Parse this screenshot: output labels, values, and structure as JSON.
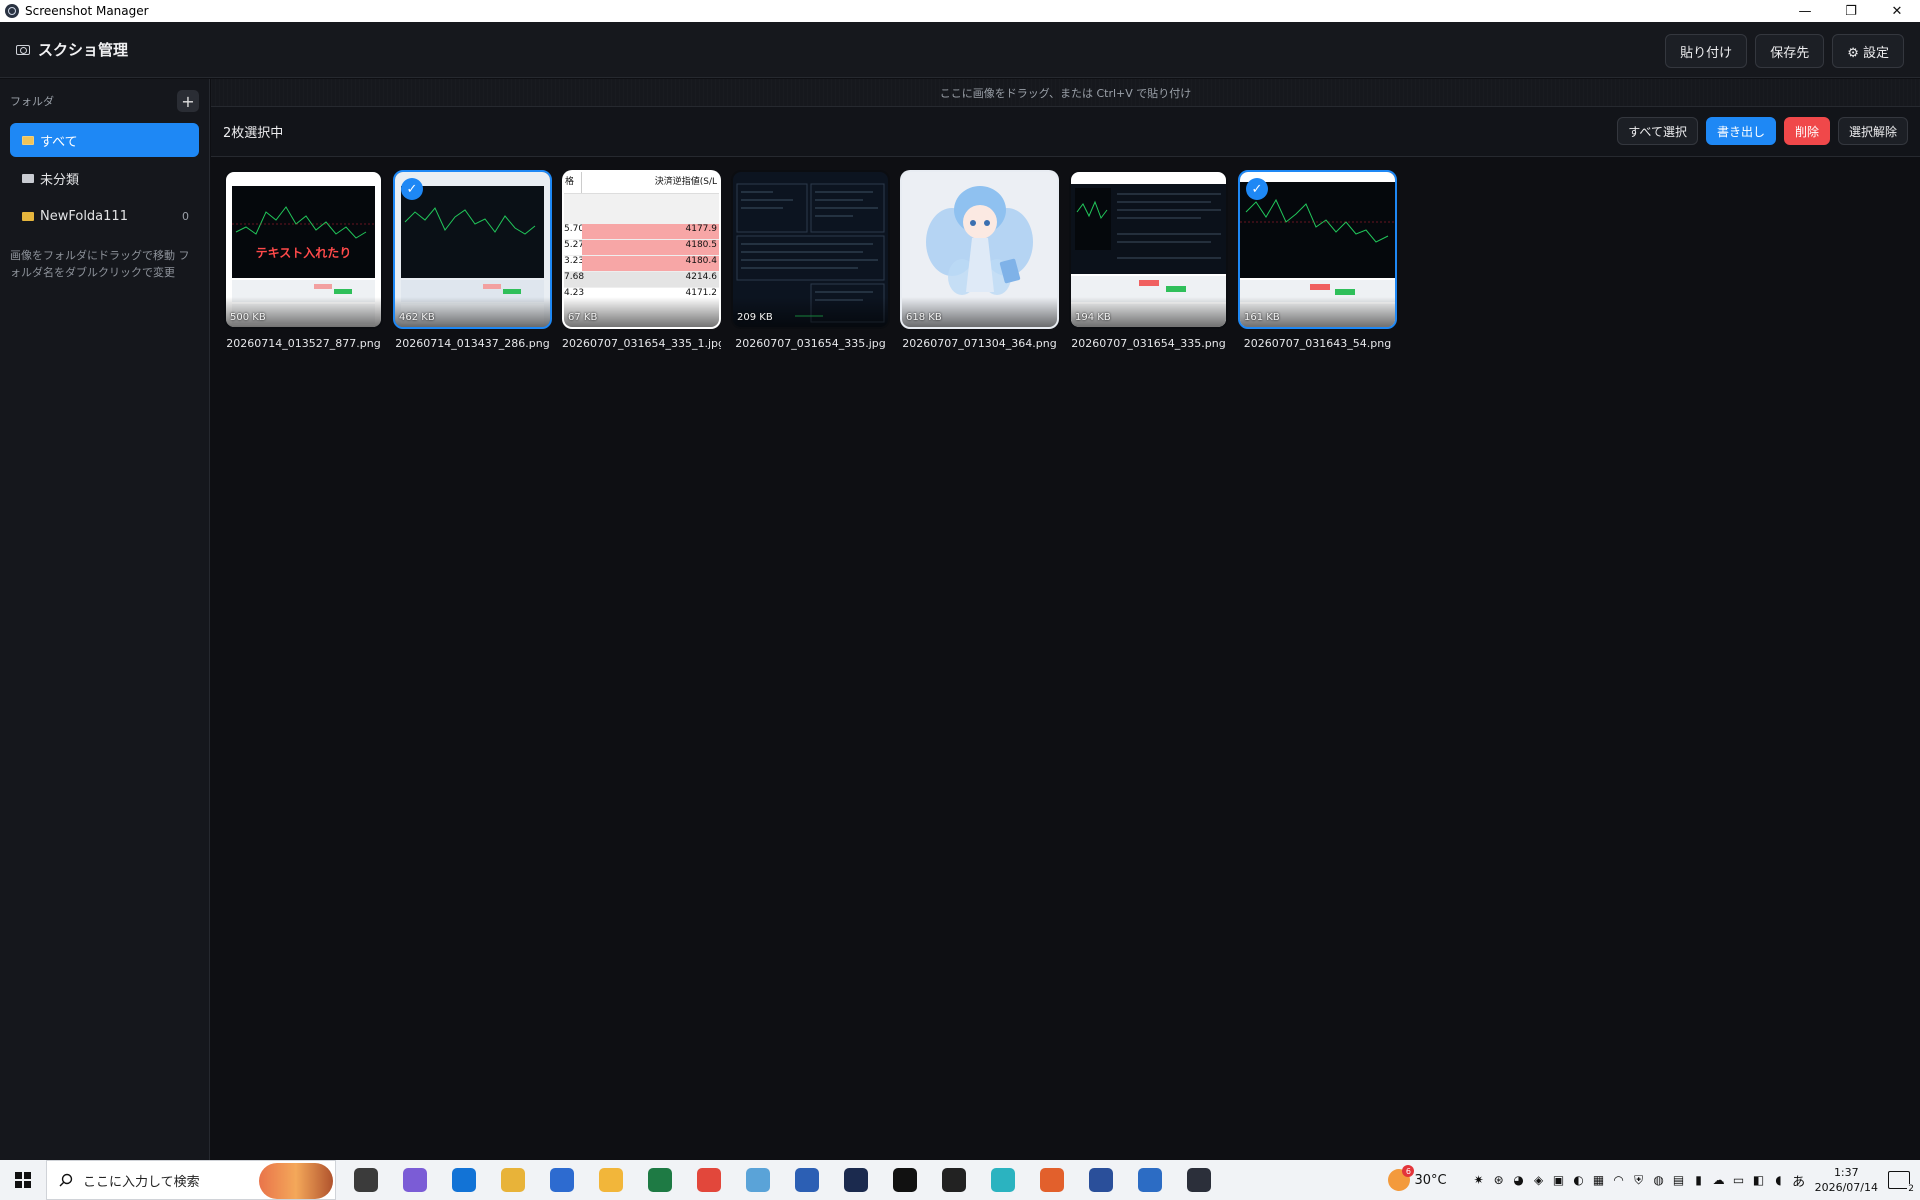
{
  "window": {
    "title": "Screenshot Manager",
    "minimize": "—",
    "restore": "❐",
    "close": "✕"
  },
  "header": {
    "brand": "スクショ管理",
    "paste_label": "貼り付け",
    "save_dest_label": "保存先",
    "settings_label": "⚙ 設定"
  },
  "sidebar": {
    "section_label": "フォルダ",
    "add_label": "+",
    "items": [
      {
        "label": "すべて",
        "count": ""
      },
      {
        "label": "未分類",
        "count": ""
      },
      {
        "label": "NewFolda111",
        "count": "0"
      }
    ],
    "hint": "画像をフォルダにドラッグで移動 フォルダ名をダブルクリックで変更"
  },
  "dropzone": {
    "text": "ここに画像をドラッグ、または Ctrl+V で貼り付け"
  },
  "selection": {
    "count_label": "2枚選択中",
    "select_all_label": "すべて選択",
    "export_label": "書き出し",
    "delete_label": "削除",
    "deselect_label": "選択解除"
  },
  "images": [
    {
      "name": "20260714_013527_877.png",
      "size": "500 KB",
      "selected": false,
      "overlay_text": "テキスト入れたり"
    },
    {
      "name": "20260714_013437_286.png",
      "size": "462 KB",
      "selected": true
    },
    {
      "name": "20260707_031654_335_1.jpg",
      "size": "67 KB",
      "selected": false,
      "header_left": "格",
      "header_right": "決済逆指値(S/L",
      "rows": [
        {
          "left": "5.70",
          "right": "4177.9"
        },
        {
          "left": "5.27",
          "right": "4180.5"
        },
        {
          "left": "3.23",
          "right": "4180.4"
        },
        {
          "left": "7.68",
          "right": "4214.6"
        },
        {
          "left": "4.23",
          "right": "4171.2"
        }
      ]
    },
    {
      "name": "20260707_031654_335.jpg",
      "size": "209 KB",
      "selected": false
    },
    {
      "name": "20260707_071304_364.png",
      "size": "618 KB",
      "selected": false
    },
    {
      "name": "20260707_031654_335.png",
      "size": "194 KB",
      "selected": false
    },
    {
      "name": "20260707_031643_54.png",
      "size": "161 KB",
      "selected": true
    }
  ],
  "check_glyph": "✓",
  "taskbar": {
    "search_placeholder": "ここに入力して検索",
    "temperature": "30°C",
    "weather_badge": "6",
    "time": "1:37",
    "date": "2026/07/14",
    "ime": "あ",
    "notification_count": "2",
    "app_colors": [
      "#3b3b3b",
      "#7b5cd6",
      "#1273d6",
      "#e8b339",
      "#2d6bd0",
      "#f2b63a",
      "#1e7a44",
      "#e2473b",
      "#5aa3d8",
      "#2c5fb4",
      "#1b2a4e",
      "#111111",
      "#222222",
      "#2bb3c0",
      "#e2602c",
      "#2a4f9a",
      "#2c6cc4",
      "#2b2f3a"
    ]
  },
  "colors": {
    "accent": "#1e88f5",
    "danger": "#f0484a",
    "background": "#0e0f13"
  }
}
